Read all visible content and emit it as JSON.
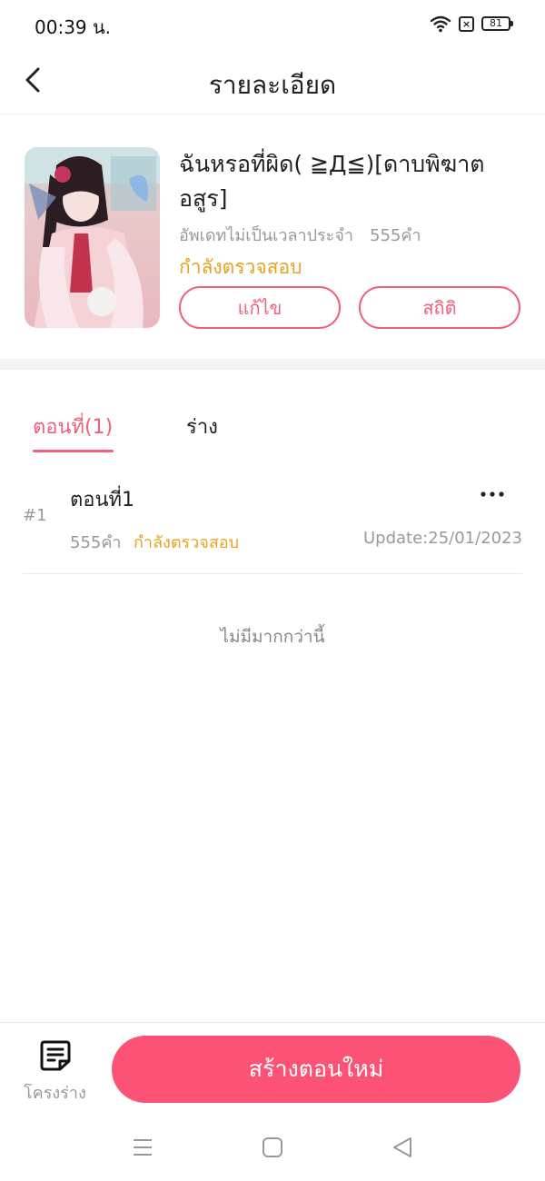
{
  "status_bar": {
    "time": "00:39 น.",
    "battery": "81",
    "wifi_icon": "wifi-icon",
    "sim_icon": "no-sim-icon"
  },
  "header": {
    "title": "รายละเอียด",
    "back_icon": "back-arrow-icon"
  },
  "book": {
    "title": "ฉันหรอที่ผิด( ≧Д≦)[ดาบพิฆาตอสูร]",
    "update_frequency": "อัพเดทไม่เป็นเวลาประจำ",
    "word_count": "555คำ",
    "status": "กำลังตรวจสอบ",
    "edit_label": "แก้ไข",
    "stats_label": "สถิติ"
  },
  "tabs": [
    {
      "label": "ตอนที่(1)",
      "active": true
    },
    {
      "label": "ร่าง",
      "active": false
    }
  ],
  "chapters": [
    {
      "index": "#1",
      "title": "ตอนที่1",
      "words": "555คำ",
      "status": "กำลังตรวจสอบ",
      "update": "Update:25/01/2023"
    }
  ],
  "list_end_text": "ไม่มีมากกว่านี้",
  "bottom_bar": {
    "drafts_label": "โครงร่าง",
    "create_label": "สร้างตอนใหม่"
  },
  "colors": {
    "accent": "#fb5275",
    "pink_text": "#f0607c",
    "status_orange": "#e9a11f",
    "muted": "#999999"
  }
}
